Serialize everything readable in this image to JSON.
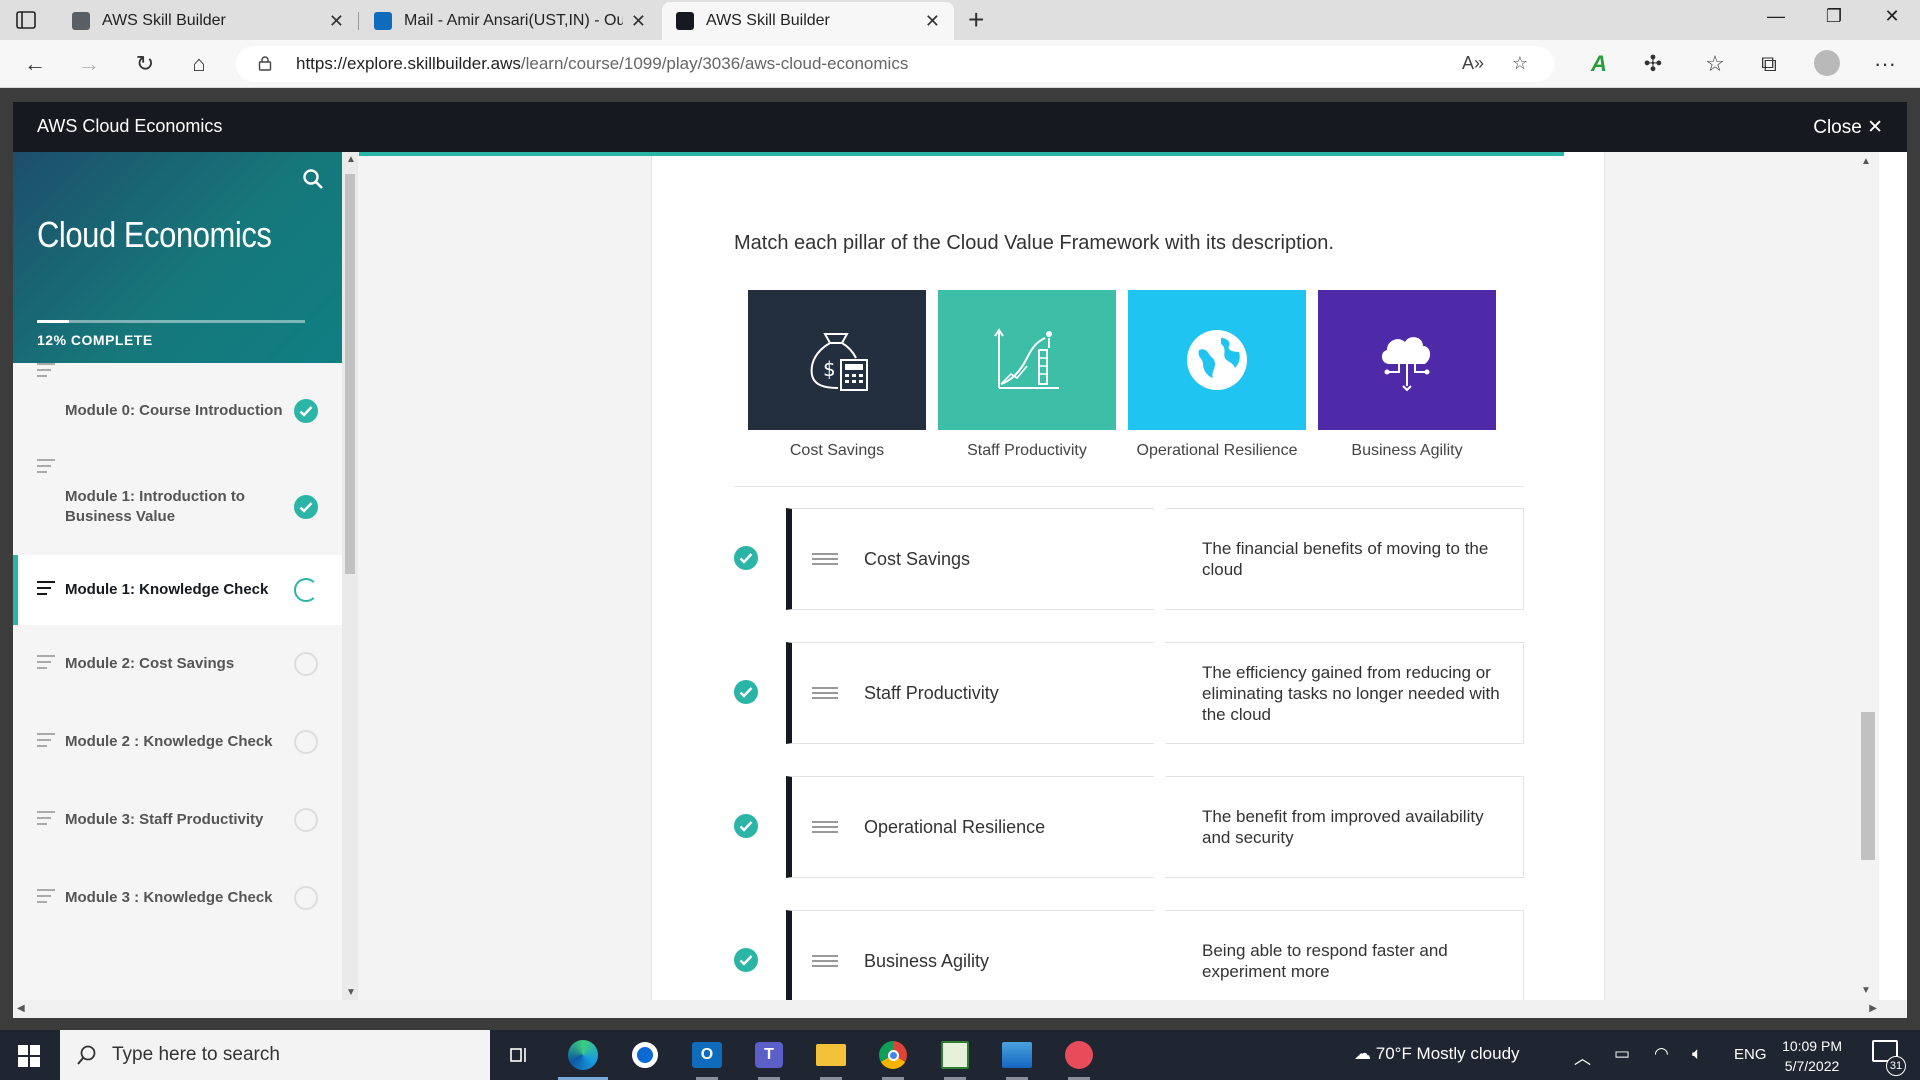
{
  "browser": {
    "tabs": [
      {
        "title": "AWS Skill Builder",
        "active": false
      },
      {
        "title": "Mail - Amir Ansari(UST,IN) - Outl",
        "active": false
      },
      {
        "title": "AWS Skill Builder",
        "active": true
      }
    ],
    "url_host": "https://explore.skillbuilder.aws",
    "url_path": "/learn/course/1099/play/3036/aws-cloud-economics"
  },
  "app": {
    "title": "AWS Cloud Economics",
    "close_label": "Close"
  },
  "sidebar": {
    "course_title": "Cloud Economics",
    "progress_label": "12% COMPLETE",
    "progress_fraction": 0.12,
    "modules": [
      {
        "label": "Module 0: Course Introduction",
        "status": "complete"
      },
      {
        "label": "Module 1: Introduction to Business Value",
        "status": "complete"
      },
      {
        "label": "Module 1: Knowledge Check",
        "status": "in-progress"
      },
      {
        "label": "Module 2: Cost Savings",
        "status": "not-started"
      },
      {
        "label": "Module 2 : Knowledge Check",
        "status": "not-started"
      },
      {
        "label": "Module 3: Staff Productivity",
        "status": "not-started"
      },
      {
        "label": "Module 3 : Knowledge Check",
        "status": "not-started"
      }
    ]
  },
  "lesson": {
    "question": "Match each pillar of the Cloud Value Framework with its description.",
    "pillars": [
      {
        "caption": "Cost Savings",
        "icon": "money-bag-calculator-icon",
        "color": "#232f3e"
      },
      {
        "caption": "Staff Productivity",
        "icon": "growth-chart-icon",
        "color": "#3dbfa7"
      },
      {
        "caption": "Operational Resilience",
        "icon": "globe-icon",
        "color": "#1fc4f0"
      },
      {
        "caption": "Business Agility",
        "icon": "cloud-network-icon",
        "color": "#4f2aa8"
      }
    ],
    "matches": [
      {
        "item": "Cost Savings",
        "description": "The financial benefits of moving to the cloud"
      },
      {
        "item": "Staff Productivity",
        "description": "The efficiency gained from reducing or eliminating tasks no longer needed with the cloud"
      },
      {
        "item": "Operational Resilience",
        "description": "The benefit from improved availability and security"
      },
      {
        "item": "Business Agility",
        "description": "Being able to respond faster and experiment more"
      }
    ]
  },
  "taskbar": {
    "search_placeholder": "Type here to search",
    "weather": "70°F  Mostly cloudy",
    "language": "ENG",
    "time": "10:09 PM",
    "date": "5/7/2022",
    "notification_count": "31"
  },
  "colors": {
    "accent": "#2bb5a6",
    "header": "#16191f"
  }
}
